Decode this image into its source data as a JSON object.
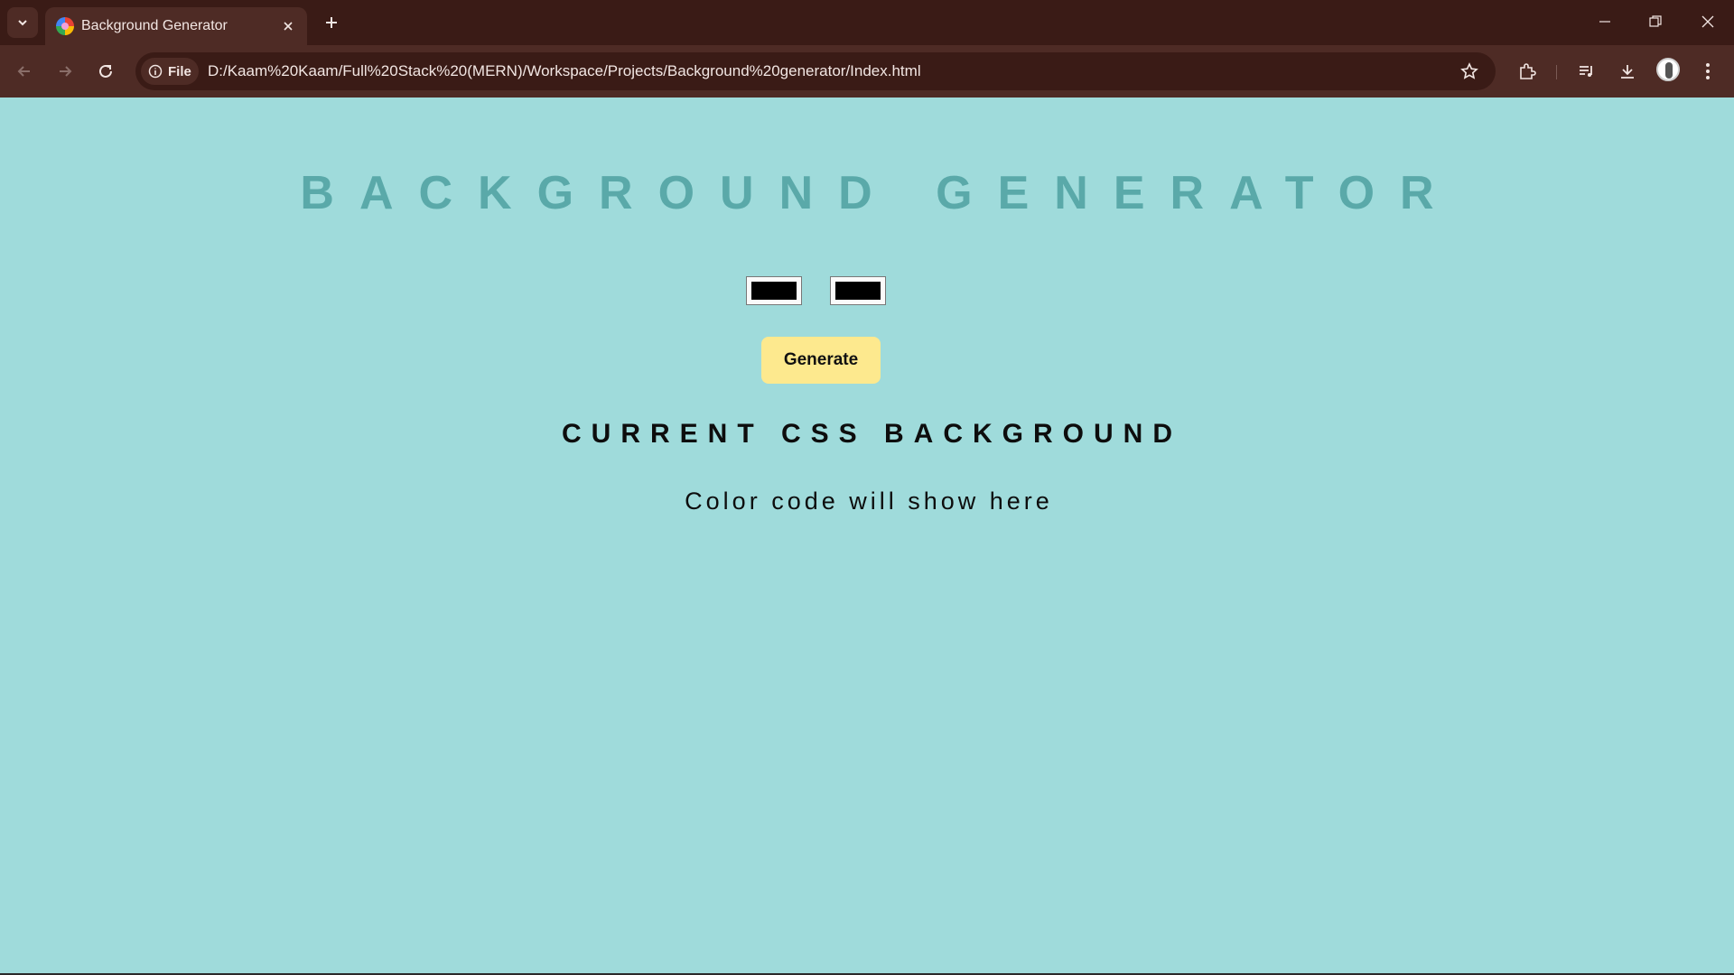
{
  "browser": {
    "tab_title": "Background Generator",
    "site_chip_label": "File",
    "url": "D:/Kaam%20Kaam/Full%20Stack%20(MERN)/Workspace/Projects/Background%20generator/Index.html"
  },
  "page": {
    "heading": "BACKGROUND GENERATOR",
    "color1_value": "#000000",
    "color2_value": "#000000",
    "generate_label": "Generate",
    "subheading": "CURRENT CSS BACKGROUND",
    "code_placeholder": "Color code will show here"
  },
  "colors": {
    "page_background": "#9fdbdb",
    "heading_color": "#5aa9a9",
    "button_color": "#fde98e",
    "chrome_dark": "#3a1b16",
    "chrome_toolbar": "#4e2b25"
  }
}
